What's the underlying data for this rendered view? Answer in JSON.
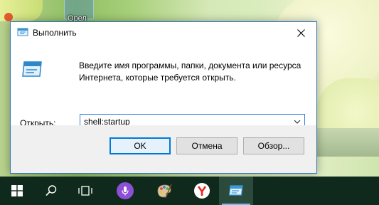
{
  "desktop": {
    "icon_label": "Орел"
  },
  "dialog": {
    "title": "Выполнить",
    "description_line1": "Введите имя программы, папки, документа или ресурса",
    "description_line2": "Интернета, которые требуется открыть.",
    "open_label_prefix": "О",
    "open_label_rest": "ткрыть:",
    "open_value": "shell:startup",
    "buttons": {
      "ok": "OK",
      "cancel": "Отмена",
      "browse": "Обзор..."
    }
  },
  "taskbar": {
    "items": [
      "start-icon",
      "search-icon",
      "task-view-icon",
      "cortana-icon",
      "paint-icon",
      "yandex-browser-icon",
      "run-icon"
    ],
    "accent": "#76b9ed"
  }
}
